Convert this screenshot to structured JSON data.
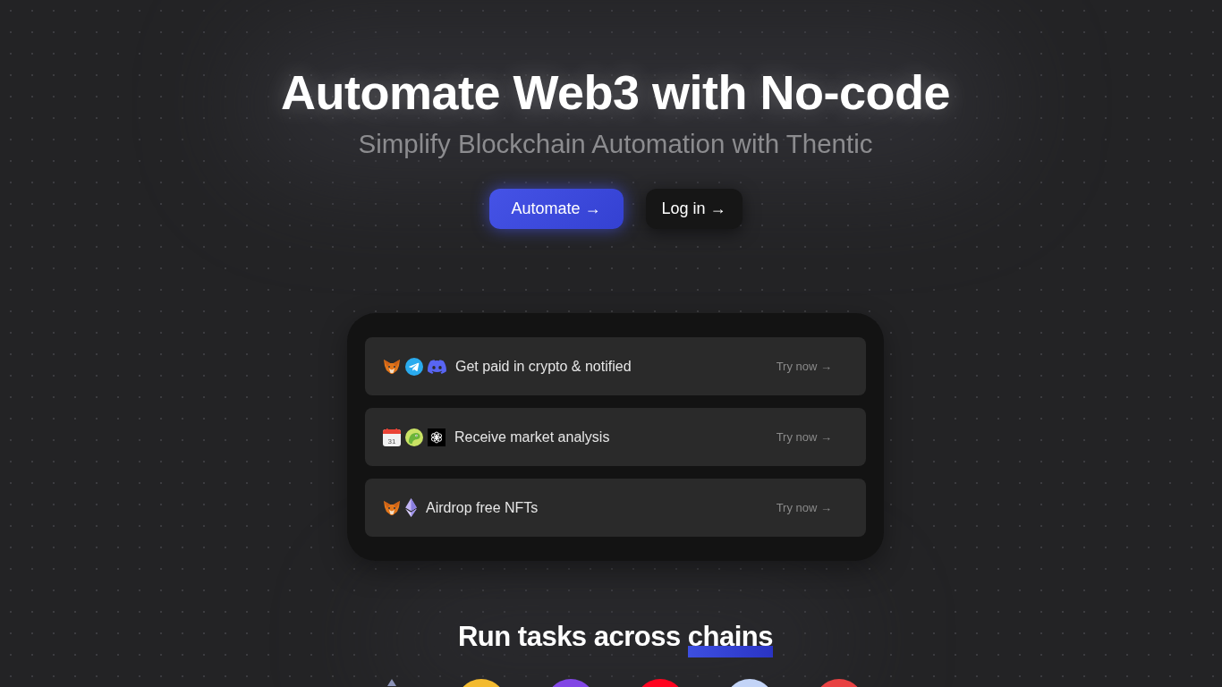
{
  "hero": {
    "title": "Automate Web3 with No-code",
    "subtitle": "Simplify Blockchain Automation with Thentic"
  },
  "buttons": [
    {
      "label": "Automate →",
      "kind": "primary"
    },
    {
      "label": "Log in →",
      "kind": "secondary"
    }
  ],
  "tasks": [
    {
      "icons": [
        {
          "kind": "fox"
        },
        {
          "kind": "plane"
        },
        {
          "kind": "controller"
        }
      ],
      "title": "Get paid in crypto & notified",
      "action": "Try now →"
    },
    {
      "icons": [
        {
          "kind": "calendar",
          "label": "31"
        },
        {
          "kind": "gecko"
        },
        {
          "kind": "knot"
        }
      ],
      "title": "Receive market analysis",
      "action": "Try now →"
    },
    {
      "icons": [
        {
          "kind": "fox"
        },
        {
          "kind": "diamond"
        }
      ],
      "title": "Airdrop free NFTs",
      "action": "Try now →"
    }
  ],
  "chains_section": {
    "heading": "Run tasks across",
    "highlight": "chains",
    "chains": [
      {
        "kind": "diamond",
        "color": "#8c93b8"
      },
      {
        "kind": "disc",
        "color": "#f3ba2f"
      },
      {
        "kind": "disc",
        "color": "#8247e5"
      },
      {
        "kind": "disc",
        "color": "#ff0420"
      },
      {
        "kind": "disc",
        "color": "#c3d4f7"
      },
      {
        "kind": "disc",
        "color": "#e84142"
      }
    ]
  }
}
